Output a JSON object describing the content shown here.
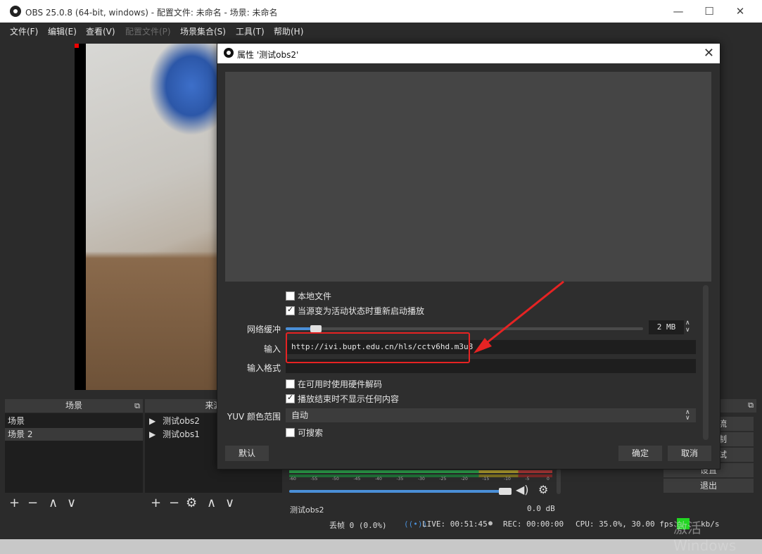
{
  "window": {
    "title": "OBS 25.0.8 (64-bit, windows) - 配置文件: 未命名 - 场景: 未命名"
  },
  "menu": [
    "文件(F)",
    "编辑(E)",
    "查看(V)",
    "配置文件(P)",
    "场景集合(S)",
    "工具(T)",
    "帮助(H)"
  ],
  "panels": {
    "scenes": {
      "title": "场景",
      "items": [
        "场景",
        "场景 2"
      ]
    },
    "sources": {
      "title": "来源",
      "items": [
        "测试obs2",
        "测试obs1"
      ]
    }
  },
  "mixer": {
    "source": "测试obs2",
    "db": "0.0 dB",
    "scale": [
      "-60",
      "-55",
      "-50",
      "-45",
      "-40",
      "-35",
      "-30",
      "-25",
      "-20",
      "-15",
      "-10",
      "-5",
      "0"
    ]
  },
  "controls": [
    "流",
    "制",
    "试",
    "设置",
    "退出"
  ],
  "status": {
    "dropped": "丢帧 0 (0.0%)",
    "live": "LIVE: 00:51:45",
    "rec": "REC: 00:00:00",
    "cpu": "CPU: 35.0%, 30.00 fps",
    "kbps": "kb/s",
    "watermark": "激活 Windows"
  },
  "dialog": {
    "title": "属性 '测试obs2'",
    "local_file": "本地文件",
    "restart_label": "当源变为活动状态时重新启动播放",
    "network_buffer_label": "网络缓冲",
    "network_buffer_value": "2 MB",
    "network_buffer_level": 0.08,
    "input_label": "输入",
    "input_value": "http://ivi.bupt.edu.cn/hls/cctv6hd.m3u8",
    "input_format_label": "输入格式",
    "input_format_value": "",
    "hw_decode_label": "在可用时使用硬件解码",
    "hide_on_end_label": "播放结束时不显示任何内容",
    "yuv_label": "YUV 颜色范围",
    "yuv_value": "自动",
    "seekable_label": "可搜索",
    "defaults_button": "默认",
    "ok_button": "确定",
    "cancel_button": "取消"
  },
  "colors": {
    "annotation_red": "#e62323",
    "slider_blue": "#4a8fd8",
    "meter_green": "#2fa84f"
  }
}
